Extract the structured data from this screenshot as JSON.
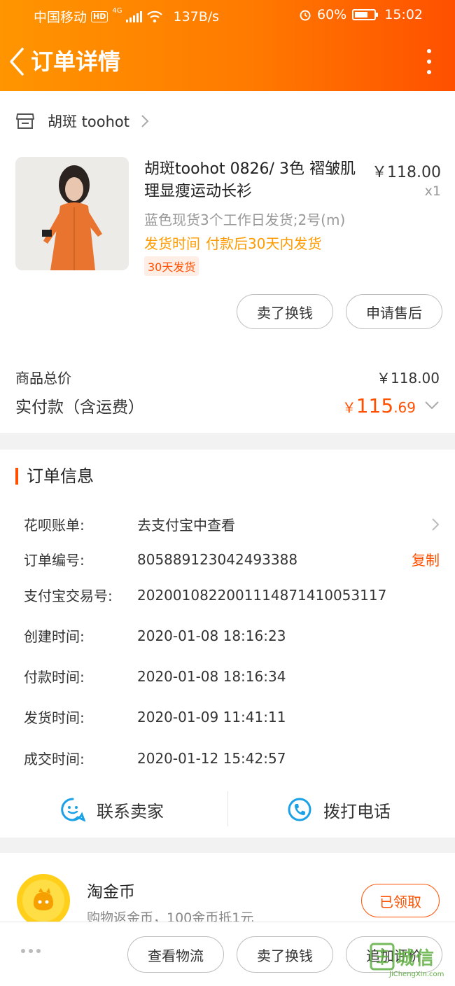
{
  "status_bar": {
    "carrier": "中国移动",
    "hd_badge": "HD",
    "network": "4G",
    "speed": "137B/s",
    "battery": "60%",
    "time": "15:02",
    "icons": [
      "signal-icon",
      "wifi-icon",
      "alarm-icon",
      "battery-icon"
    ]
  },
  "header": {
    "title": "订单详情",
    "back_icon": "chevron-left-icon",
    "more_icon": "more-vertical-icon",
    "gradient": [
      "#ff9500",
      "#ff5000"
    ]
  },
  "shop": {
    "name": "胡斑 toohot",
    "icon": "store-icon"
  },
  "product": {
    "title": "胡斑toohot 0826/ 3色 褶皱肌理显瘦运动长衫",
    "price": "￥118.00",
    "qty": "x1",
    "spec": "蓝色现货3个工作日发货;2号(m)",
    "ship_label": "发货时间",
    "ship_value": "付款后30天内发货",
    "tag": "30天发货"
  },
  "card_actions": {
    "sell": "卖了换钱",
    "after_sale": "申请售后"
  },
  "summary": {
    "goods_total_label": "商品总价",
    "goods_total_value": "￥118.00",
    "paid_label": "实付款（含运费）",
    "paid_currency": "￥",
    "paid_int": "115",
    "paid_dec": ".69"
  },
  "order_info": {
    "title": "订单信息",
    "rows": [
      {
        "label": "花呗账单:",
        "value": "去支付宝中查看"
      },
      {
        "label": "订单编号:",
        "value": "805889123042493388",
        "action": "复制"
      },
      {
        "label": "支付宝交易号:",
        "value": "2020010822001114871410053117"
      },
      {
        "label": "创建时间:",
        "value": "2020-01-08 18:16:23"
      },
      {
        "label": "付款时间:",
        "value": "2020-01-08 18:16:34"
      },
      {
        "label": "发货时间:",
        "value": "2020-01-09 11:41:11"
      },
      {
        "label": "成交时间:",
        "value": "2020-01-12 15:42:57"
      }
    ],
    "contact_seller": "联系卖家",
    "call_phone": "拨打电话"
  },
  "coins": {
    "title": "淘金币",
    "desc": "购物返金币，100金币抵1元",
    "button": "已领取"
  },
  "bottom_bar": {
    "logistics": "查看物流",
    "sell": "卖了换钱",
    "review": "追加评价"
  },
  "watermark": {
    "text": "城信",
    "url": "JiChengXin.com"
  },
  "colors": {
    "accent": "#ff5000",
    "ship_orange": "#ff9a00",
    "contact_blue": "#1aa1e6"
  }
}
